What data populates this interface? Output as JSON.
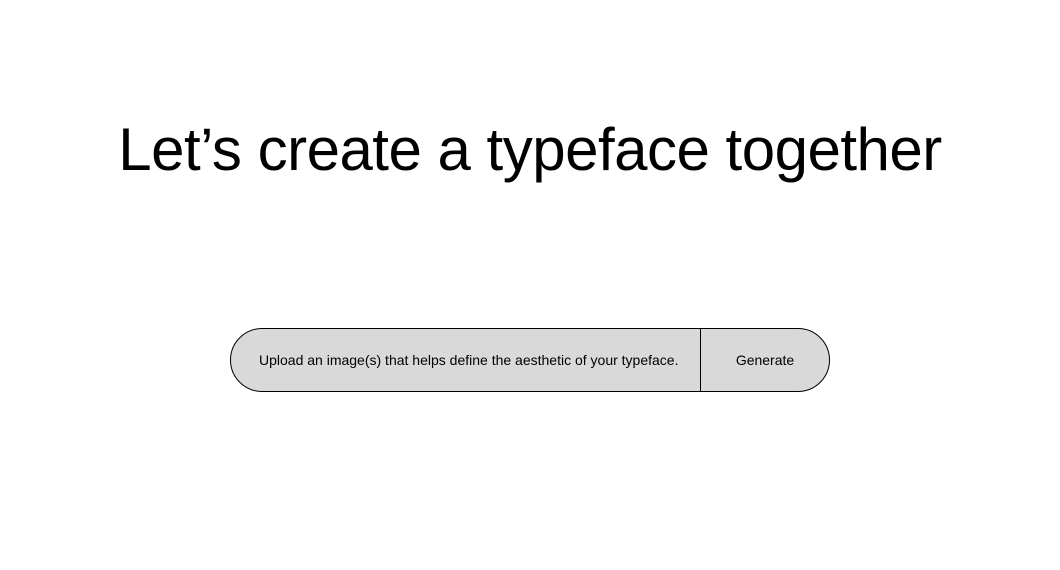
{
  "heading": "Let’s create a typeface together",
  "input_bar": {
    "upload_prompt": "Upload an image(s) that helps define the aesthetic of your typeface.",
    "generate_label": "Generate"
  }
}
